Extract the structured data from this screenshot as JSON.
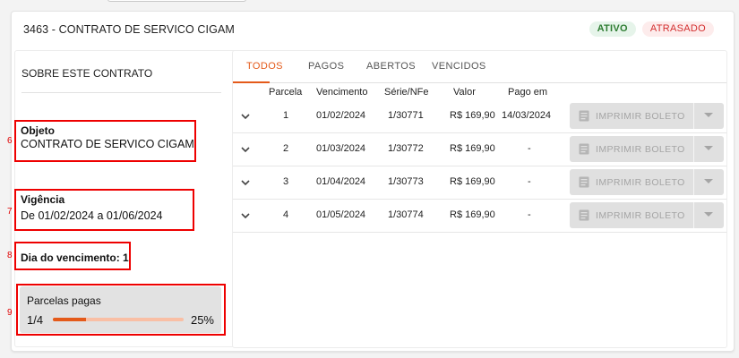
{
  "contract": {
    "title": "3463 - CONTRATO DE SERVICO CIGAM",
    "badges": [
      {
        "label": "ATIVO",
        "color": "#2e7d32"
      },
      {
        "label": "ATRASADO",
        "color": "#d32f2f"
      }
    ]
  },
  "about": {
    "header": "SOBRE ESTE CONTRATO",
    "objeto_label": "Objeto",
    "objeto_value": "CONTRATO DE SERVICO CIGAM",
    "vigencia_label": "Vigência",
    "vigencia_value": "De 01/02/2024 a 01/06/2024",
    "vencimento_label": "Dia do vencimento: 1",
    "parcelas_label": "Parcelas pagas",
    "parcelas_fraction": "1/4",
    "parcelas_percent": "25%",
    "parcelas_progress": 0.25
  },
  "annotations": [
    "6",
    "7",
    "8",
    "9"
  ],
  "tabs": [
    "TODOS",
    "PAGOS",
    "ABERTOS",
    "VENCIDOS"
  ],
  "active_tab": "TODOS",
  "accent_color": "#e45a1a",
  "table": {
    "headers": [
      "Parcela",
      "Vencimento",
      "Série/NFe",
      "Valor",
      "Pago em"
    ],
    "rows": [
      {
        "parcela": "1",
        "vencimento": "01/02/2024",
        "nfe": "1/30771",
        "valor": "R$ 169,90",
        "pago_em": "14/03/2024"
      },
      {
        "parcela": "2",
        "vencimento": "01/03/2024",
        "nfe": "1/30772",
        "valor": "R$ 169,90",
        "pago_em": "-"
      },
      {
        "parcela": "3",
        "vencimento": "01/04/2024",
        "nfe": "1/30773",
        "valor": "R$ 169,90",
        "pago_em": "-"
      },
      {
        "parcela": "4",
        "vencimento": "01/05/2024",
        "nfe": "1/30774",
        "valor": "R$ 169,90",
        "pago_em": "-"
      }
    ],
    "button_label": "IMPRIMIR BOLETO",
    "button_icon": "document-icon",
    "expand_icon": "chevron-down-icon"
  }
}
